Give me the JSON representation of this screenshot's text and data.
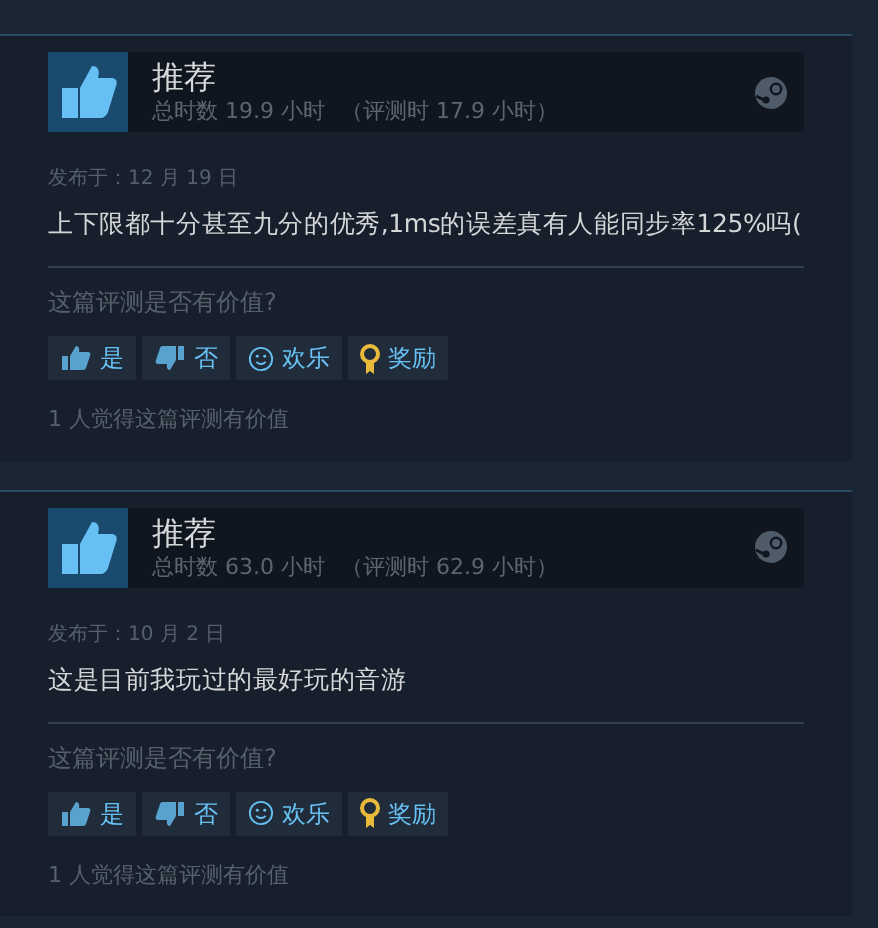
{
  "reviews": [
    {
      "verdict": "推荐",
      "playtime": "总时数 19.9 小时",
      "playtime_at_review": "（评测时 17.9 小时）",
      "posted": "发布于：12 月 19 日",
      "text": "上下限都十分甚至九分的优秀,1ms的误差真有人能同步率125%吗(",
      "helpful_prompt": "这篇评测是否有价值?",
      "buttons": [
        {
          "kind": "yes",
          "label": "是"
        },
        {
          "kind": "no",
          "label": "否"
        },
        {
          "kind": "funny",
          "label": "欢乐"
        },
        {
          "kind": "award",
          "label": "奖励"
        }
      ],
      "helpful_count": "1 人觉得这篇评测有价值"
    },
    {
      "verdict": "推荐",
      "playtime": "总时数 63.0 小时",
      "playtime_at_review": "（评测时 62.9 小时）",
      "posted": "发布于：10 月 2 日",
      "text": "这是目前我玩过的最好玩的音游",
      "helpful_prompt": "这篇评测是否有价值?",
      "buttons": [
        {
          "kind": "yes",
          "label": "是"
        },
        {
          "kind": "no",
          "label": "否"
        },
        {
          "kind": "funny",
          "label": "欢乐"
        },
        {
          "kind": "award",
          "label": "奖励"
        }
      ],
      "helpful_count": "1 人觉得这篇评测有价值"
    }
  ]
}
